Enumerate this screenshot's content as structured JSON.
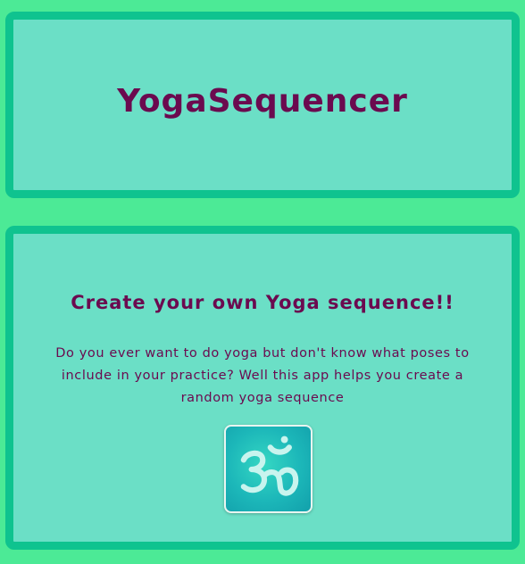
{
  "header": {
    "title": "YogaSequencer"
  },
  "main": {
    "headline": "Create your own Yoga sequence!!",
    "description": "Do you ever want to do yoga but don't know what poses to include in your practice? Well this app helps you create a random yoga sequence",
    "app_icon": "om-icon"
  },
  "colors": {
    "page_background": "#4cea96",
    "panel_border": "#0fc38f",
    "panel_fill": "#6bdfc6",
    "text": "#6b0a4f",
    "icon_fill": "#1cb7b9",
    "icon_symbol": "#c8f4ee"
  }
}
